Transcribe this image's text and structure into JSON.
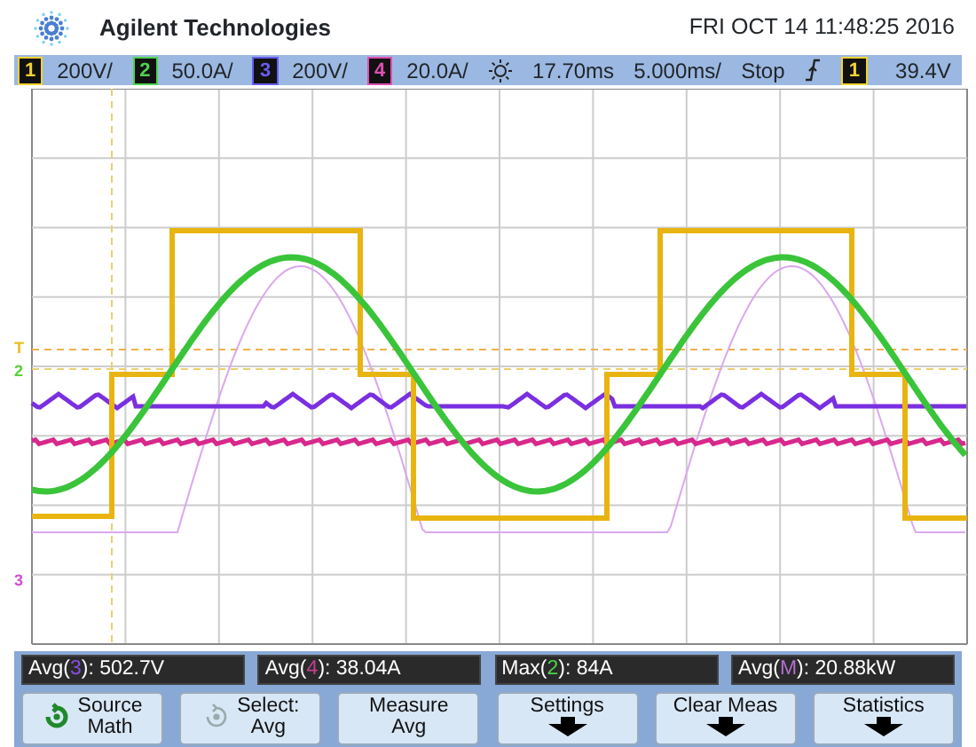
{
  "header": {
    "brand": "Agilent Technologies",
    "datetime": "FRI OCT 14 11:48:25 2016"
  },
  "status_bar": {
    "channels": [
      {
        "number": "1",
        "color": "#f2d233",
        "scale": "200V/"
      },
      {
        "number": "2",
        "color": "#4fd14f",
        "scale": "50.0A/"
      },
      {
        "number": "3",
        "color": "#6a5cf0",
        "scale": "200V/"
      },
      {
        "number": "4",
        "color": "#e04fb0",
        "scale": "20.0A/"
      }
    ],
    "delay": "17.70ms",
    "timebase": "5.000ms/",
    "run_state": "Stop",
    "trigger": {
      "source": "1",
      "color": "#f2d233",
      "level": "39.4V"
    }
  },
  "markers": [
    {
      "label": "T",
      "color": "#e8c020"
    },
    {
      "label": "2",
      "color": "#5ccf3a"
    },
    {
      "label": "3",
      "color": "#d050d0"
    }
  ],
  "measurements": [
    {
      "prefix": "Avg(",
      "source": "3",
      "color": "#8a4fe0",
      "suffix": "): 502.7V"
    },
    {
      "prefix": "Avg(",
      "source": "4",
      "color": "#c04090",
      "suffix": "): 38.04A"
    },
    {
      "prefix": "Max(",
      "source": "2",
      "color": "#4fd14f",
      "suffix": "): 84A"
    },
    {
      "prefix": "Avg(",
      "source": "M",
      "color": "#b070d0",
      "suffix": "): 20.88kW"
    }
  ],
  "softkeys": [
    {
      "kind": "knob",
      "lines": [
        "Source",
        "Math"
      ],
      "enabled": true
    },
    {
      "kind": "knob",
      "lines": [
        "Select:",
        "Avg"
      ],
      "enabled": false
    },
    {
      "kind": "plain",
      "lines": [
        "Measure",
        "Avg"
      ],
      "enabled": true
    },
    {
      "kind": "menu",
      "lines": [
        "Settings"
      ],
      "enabled": true
    },
    {
      "kind": "menu",
      "lines": [
        "Clear Meas"
      ],
      "enabled": true
    },
    {
      "kind": "menu",
      "lines": [
        "Statistics"
      ],
      "enabled": true
    }
  ]
}
